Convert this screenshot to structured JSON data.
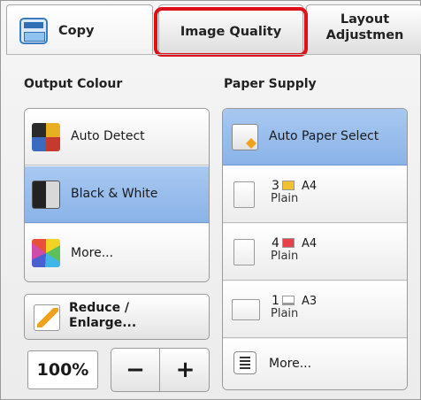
{
  "tabs": {
    "copy_label": "Copy",
    "image_quality_label": "Image Quality",
    "layout_label": "Layout\nAdjustmen"
  },
  "output_colour": {
    "title": "Output Colour",
    "options": [
      {
        "label": "Auto Detect",
        "icon": "auto-detect-colour-icon",
        "selected": false
      },
      {
        "label": "Black & White",
        "icon": "black-white-icon",
        "selected": true
      },
      {
        "label": "More...",
        "icon": "colour-palette-icon",
        "selected": false
      }
    ]
  },
  "reduce_enlarge": {
    "label": "Reduce /\nEnlarge...",
    "value": "100%",
    "minus": "−",
    "plus": "+"
  },
  "paper_supply": {
    "title": "Paper Supply",
    "auto_label": "Auto Paper Select",
    "trays": [
      {
        "number": "3",
        "type": "Plain",
        "size": "A4",
        "paper_color": "#f2c12e"
      },
      {
        "number": "4",
        "type": "Plain",
        "size": "A4",
        "paper_color": "#e8414a"
      },
      {
        "number": "1",
        "type": "Plain",
        "size": "A3",
        "paper_color": "#9a9a9a"
      }
    ],
    "more_label": "More..."
  },
  "colors": {
    "selected": "#8ab3e8",
    "highlight": "#e0101a"
  }
}
